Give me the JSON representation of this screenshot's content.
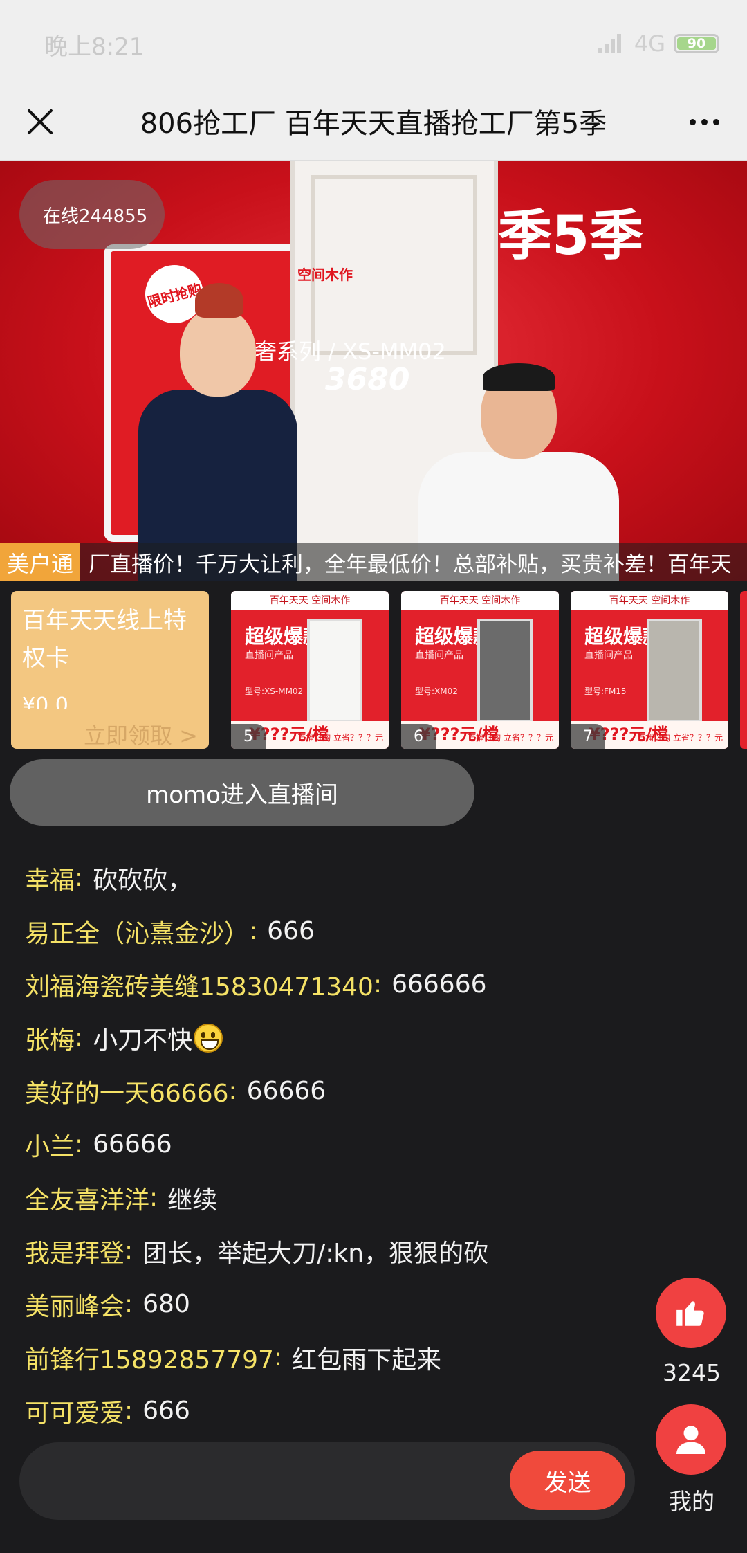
{
  "status_bar": {
    "time": "晚上8:21",
    "network": "4G",
    "battery": "90"
  },
  "header": {
    "title": "806抢工厂 百年天天直播抢工厂第5季"
  },
  "video": {
    "online_label": "在线244855",
    "overlay_series": "奢系列 / XS-MM02",
    "overlay_price": "3680",
    "overlay_season": "季5季",
    "overlay_tag": "限时抢购",
    "overlay_brand": "空间木作"
  },
  "marquee": {
    "badge": "美户通",
    "text": "厂直播价！千万大让利，全年最低价！总部补贴，买贵补差！百年天"
  },
  "coupon": {
    "title": "百年天天线上特权卡",
    "price": "¥0.0",
    "cta": "立即领取 >"
  },
  "products": [
    {
      "num": "5",
      "header": "百年天天 空间木作",
      "name": "超级爆款",
      "sub": "直播间产品",
      "model": "型号:XS-MM02",
      "price": "¥???元/樘",
      "buy": "直播订购 立省？？？元"
    },
    {
      "num": "6",
      "header": "百年天天 空间木作",
      "name": "超级爆款",
      "sub": "直播间产品",
      "model": "型号:XM02",
      "price": "¥???元/樘",
      "buy": "直播订购 立省？？？元"
    },
    {
      "num": "7",
      "header": "百年天天 空间木作",
      "name": "超级爆款",
      "sub": "直播间产品",
      "model": "型号:FM15",
      "price": "¥???元/樘",
      "buy": "直播订购 立省？？？元"
    }
  ],
  "toast": "momo进入直播间",
  "chat": [
    {
      "name": "幸福",
      "msg": "砍砍砍，",
      "emoji": false
    },
    {
      "name": "易正全（沁熹金沙）",
      "msg": "666",
      "emoji": false
    },
    {
      "name": "刘福海瓷砖美缝15830471340",
      "msg": "666666",
      "emoji": false
    },
    {
      "name": "张梅",
      "msg": "小刀不快",
      "emoji": true
    },
    {
      "name": "美好的一天66666",
      "msg": "66666",
      "emoji": false
    },
    {
      "name": "小兰",
      "msg": "66666",
      "emoji": false
    },
    {
      "name": "全友喜洋洋",
      "msg": "继续",
      "emoji": false
    },
    {
      "name": "我是拜登",
      "msg": "团长，举起大刀/:kn，狠狠的砍",
      "emoji": false
    },
    {
      "name": "美丽峰会",
      "msg": "680",
      "emoji": false
    },
    {
      "name": "前锋行15892857797",
      "msg": "红包雨下起来",
      "emoji": false
    },
    {
      "name": "可可爱爱",
      "msg": "666",
      "emoji": false
    }
  ],
  "like": {
    "count": "3245",
    "icon": "thumbs-up-icon"
  },
  "mine": {
    "label": "我的",
    "icon": "user-icon"
  },
  "input": {
    "placeholder": "",
    "value": "",
    "send_label": "发送"
  },
  "colors": {
    "accent_red": "#f04141",
    "chat_name": "#f5e266",
    "coupon_bg": "#f3c781",
    "badge_orange": "#f1a53a"
  }
}
